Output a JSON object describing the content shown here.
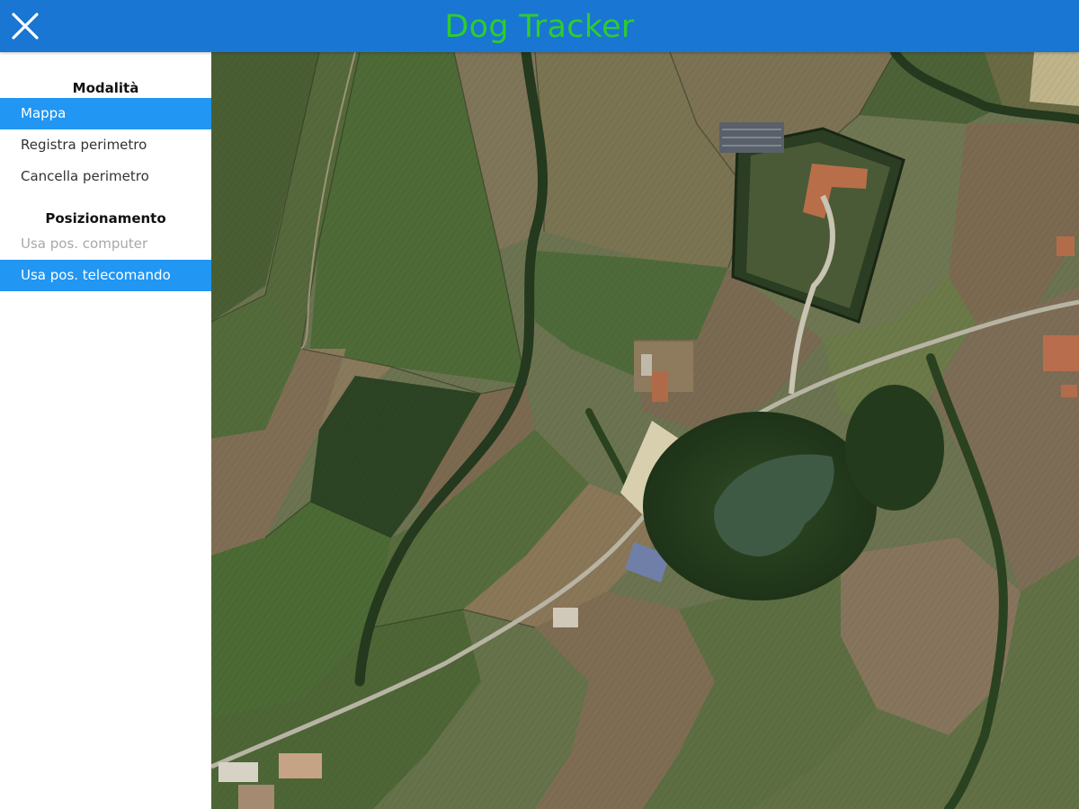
{
  "header": {
    "title": "Dog Tracker",
    "close_icon": "close-icon",
    "background_color": "#1976d2",
    "title_color": "#2ecc2e"
  },
  "sidebar": {
    "sections": [
      {
        "title": "Modalità",
        "items": [
          {
            "label": "Mappa",
            "state": "active"
          },
          {
            "label": "Registra perimetro",
            "state": "normal"
          },
          {
            "label": "Cancella perimetro",
            "state": "normal"
          }
        ]
      },
      {
        "title": "Posizionamento",
        "items": [
          {
            "label": "Usa pos. computer",
            "state": "disabled"
          },
          {
            "label": "Usa pos. telecomando",
            "state": "active"
          }
        ]
      }
    ],
    "active_color": "#2196f3"
  },
  "map": {
    "type": "satellite"
  }
}
